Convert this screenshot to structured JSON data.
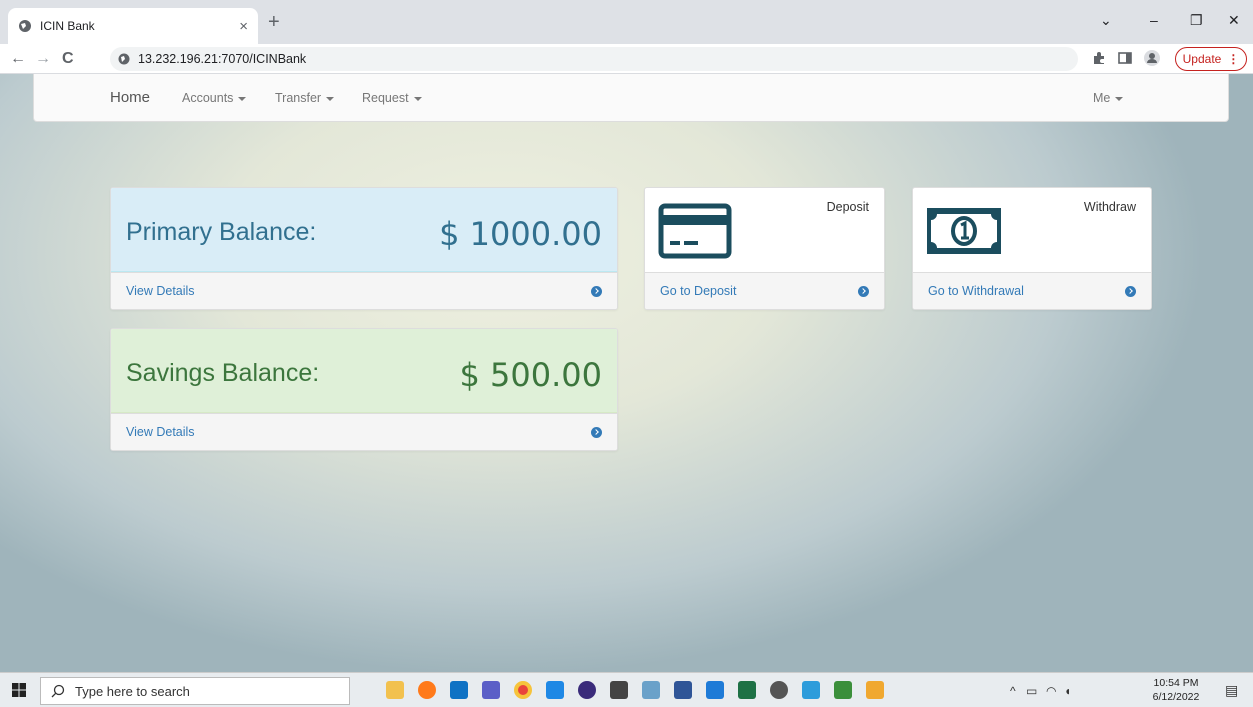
{
  "browser": {
    "tab_title": "ICIN Bank",
    "tab_close": "×",
    "new_tab": "+",
    "url": "13.232.196.21:7070/ICINBank",
    "update_label": "Update",
    "back": "←",
    "forward": "→",
    "reload": "C",
    "window_controls": {
      "minimize": "–",
      "maximize": "❐",
      "close": "✕",
      "tab_search": "⌄"
    }
  },
  "navbar": {
    "home": "Home",
    "menus": [
      "Accounts",
      "Transfer",
      "Request"
    ],
    "me": "Me"
  },
  "accounts": {
    "primary": {
      "label": "Primary Balance:",
      "amount": "$ 1000.00",
      "link": "View Details",
      "bg": "#d9edf7",
      "text_color": "#31708f"
    },
    "savings": {
      "label": "Savings Balance:",
      "amount": "$ 500.00",
      "link": "View Details",
      "bg": "#dff0d8",
      "text_color": "#3c763d"
    }
  },
  "actions": {
    "deposit": {
      "title": "Deposit",
      "link": "Go to Deposit",
      "icon": "credit-card-icon"
    },
    "withdraw": {
      "title": "Withdraw",
      "link": "Go to Withdrawal",
      "icon": "money-bill-icon"
    }
  },
  "taskbar": {
    "search_placeholder": "Type here to search",
    "time": "10:54 PM",
    "date": "6/12/2022"
  },
  "colors": {
    "link": "#337ab7",
    "icon_dark": "#1b4d5e"
  }
}
